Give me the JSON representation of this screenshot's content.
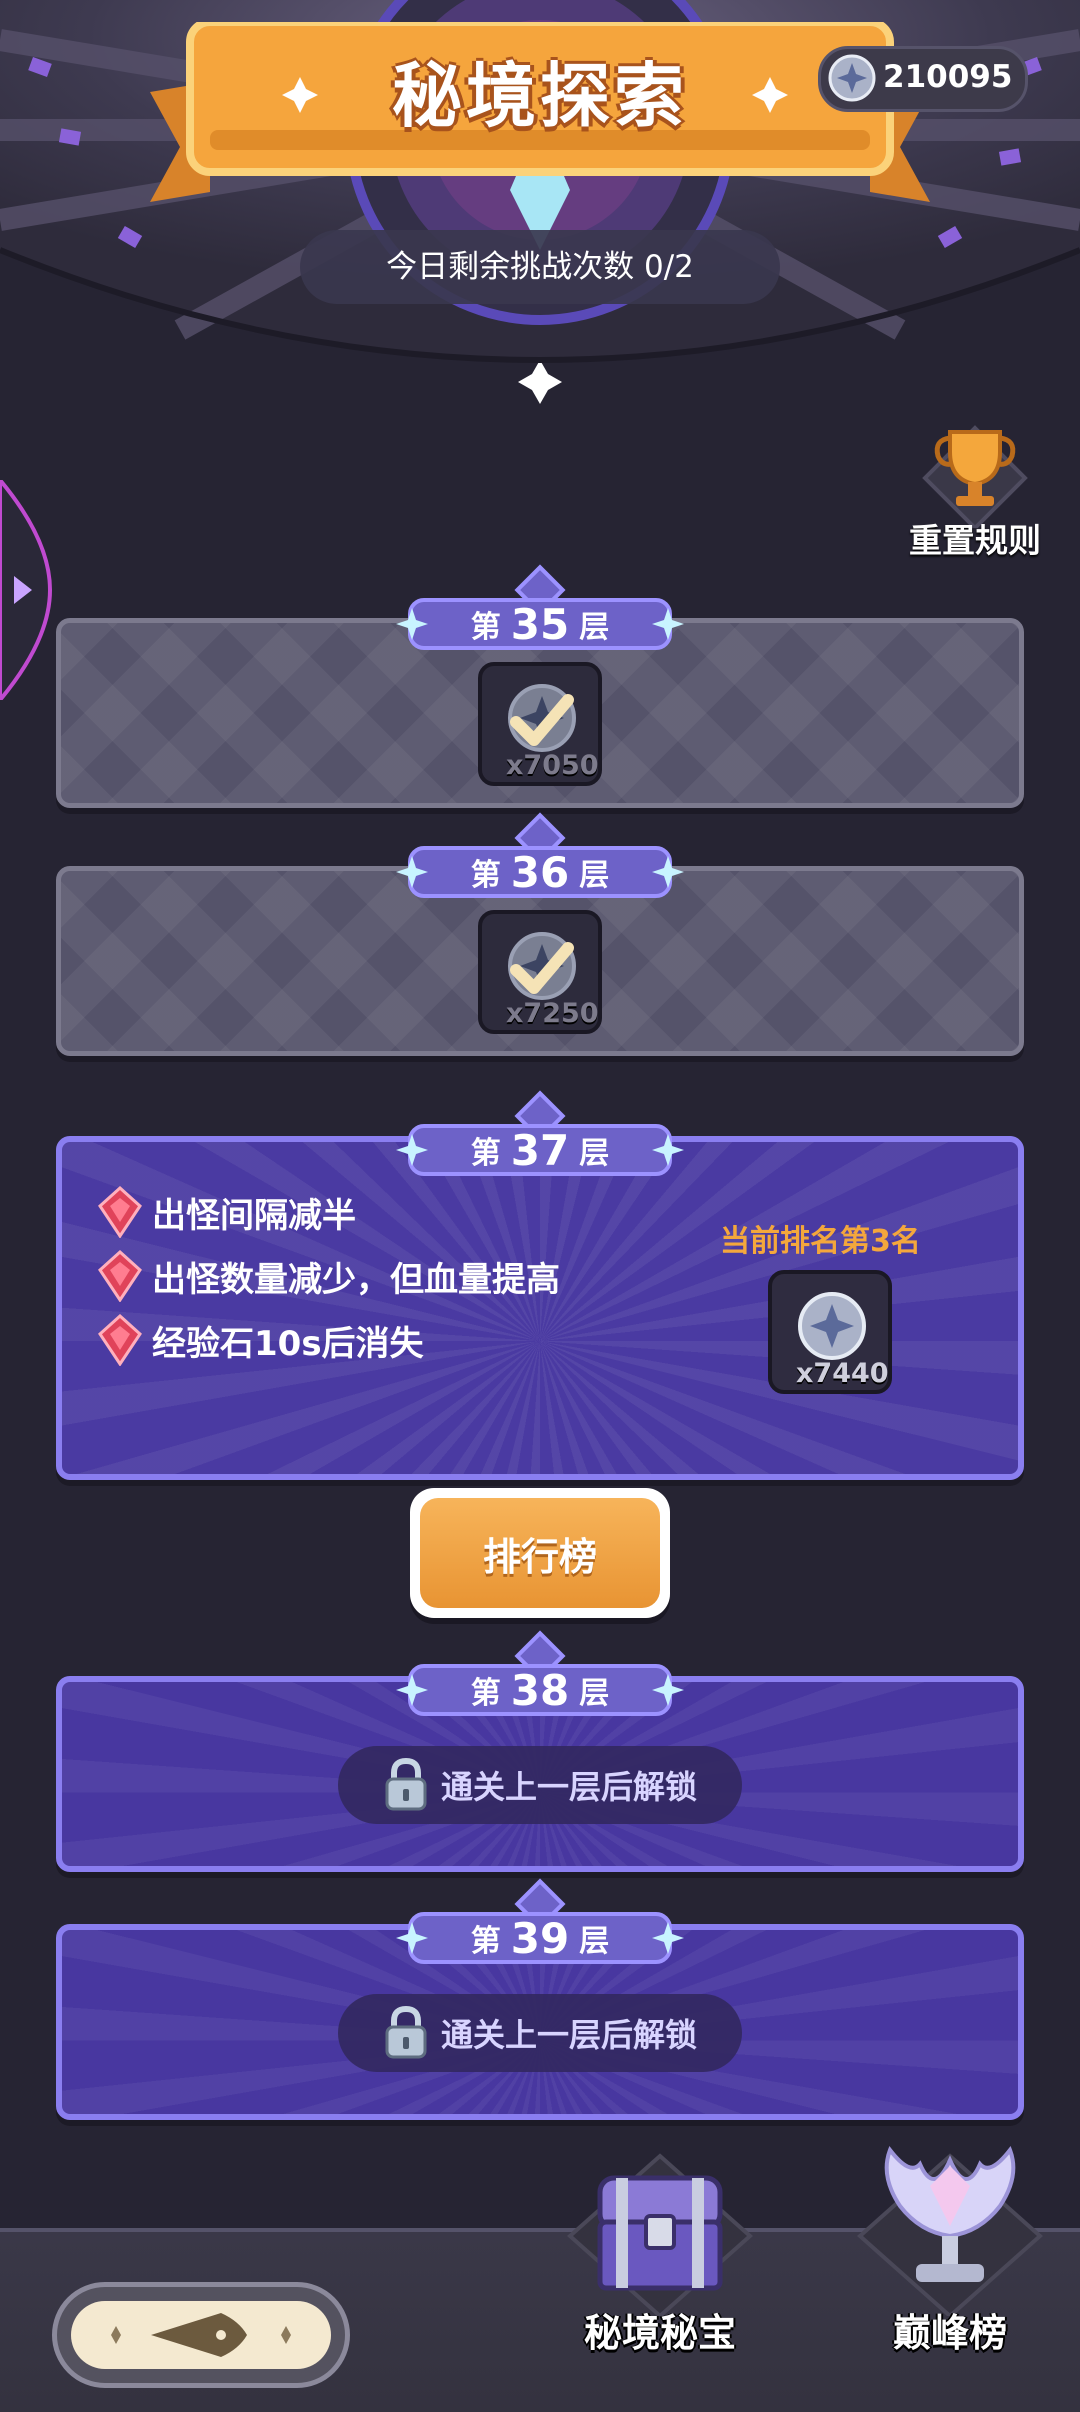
{
  "header": {
    "title": "秘境探索",
    "currency": "210095",
    "challenges_remaining": "今日剩余挑战次数 0/2"
  },
  "reset_rules": {
    "label": "重置规则"
  },
  "floors": [
    {
      "prefix": "第",
      "number": "35",
      "suffix": "层",
      "state": "cleared",
      "reward_qty": "x7050"
    },
    {
      "prefix": "第",
      "number": "36",
      "suffix": "层",
      "state": "cleared",
      "reward_qty": "x7250"
    },
    {
      "prefix": "第",
      "number": "37",
      "suffix": "层",
      "state": "current",
      "reward_qty": "x7440",
      "rank_text": "当前排名第3名",
      "modifiers": [
        "出怪间隔减半",
        "出怪数量减少，但血量提高",
        "经验石10s后消失"
      ]
    },
    {
      "prefix": "第",
      "number": "38",
      "suffix": "层",
      "state": "locked",
      "lock_text": "通关上一层后解锁"
    },
    {
      "prefix": "第",
      "number": "39",
      "suffix": "层",
      "state": "locked",
      "lock_text": "通关上一层后解锁"
    }
  ],
  "leaderboard_button": {
    "label": "排行榜"
  },
  "bottom": {
    "treasure_label": "秘境秘宝",
    "peak_label": "巅峰榜"
  },
  "colors": {
    "background": "#262433",
    "panel_active": "#4a3aa2",
    "panel_cleared": "#55536a",
    "accent_orange": "#f4a73c",
    "banner_orange": "#f2a23a"
  },
  "icons": [
    "currency-star-coin-icon",
    "trophy-icon",
    "checkmark-icon",
    "red-gem-icon",
    "lock-icon",
    "treasure-chest-icon",
    "crystal-trophy-icon",
    "back-arrow-icon"
  ]
}
